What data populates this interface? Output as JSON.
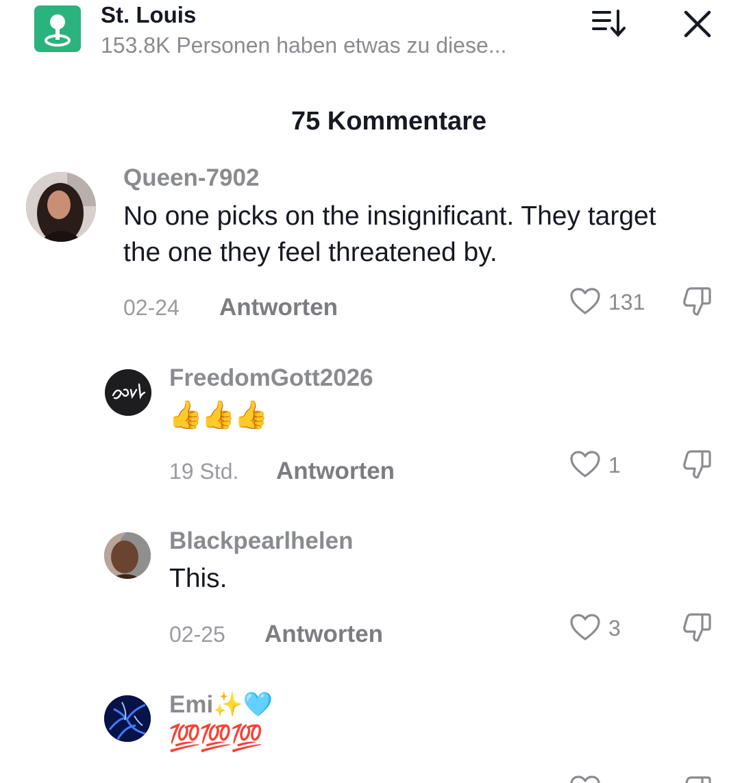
{
  "header": {
    "title": "St. Louis",
    "subtitle": "153.8K Personen haben etwas zu diese...",
    "location_icon": "location-pin-icon",
    "sort_icon": "sort-icon",
    "close_icon": "close-icon",
    "accent_color": "#2ab37d"
  },
  "comments_count": "75 Kommentare",
  "comments": [
    {
      "username": "Queen-7902",
      "text": "No one picks on the insignificant. They target the one they feel threatened by.",
      "date": "02-24",
      "reply_label": "Antworten",
      "likes": "131"
    },
    {
      "username": "FreedomGott2026",
      "text": "👍👍👍",
      "date": "19 Std.",
      "reply_label": "Antworten",
      "likes": "1"
    },
    {
      "username": "Blackpearlhelen",
      "text": "This.",
      "date": "02-25",
      "reply_label": "Antworten",
      "likes": "3"
    },
    {
      "username": "Emi✨🩵",
      "text": "💯💯💯"
    }
  ]
}
